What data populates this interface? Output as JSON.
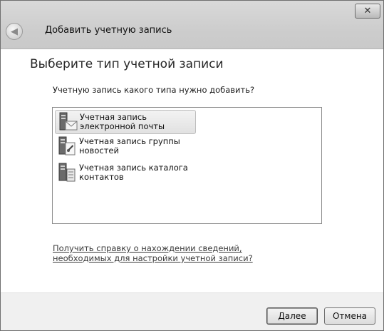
{
  "window": {
    "title": "Добавить учетную запись",
    "close_icon": "close-icon",
    "back_icon": "back-arrow-icon"
  },
  "main": {
    "heading": "Выберите тип учетной записи",
    "question": "Учетную запись какого типа нужно добавить?",
    "account_types": [
      {
        "label": "Учетная запись электронной почты",
        "icon": "email-account-icon",
        "selected": true
      },
      {
        "label": "Учетная запись группы новостей",
        "icon": "newsgroup-account-icon",
        "selected": false
      },
      {
        "label": "Учетная запись каталога контактов",
        "icon": "directory-service-icon",
        "selected": false
      }
    ],
    "help_link": "Получить справку о нахождении сведений, необходимых для настройки учетной записи?"
  },
  "footer": {
    "next_label": "Далее",
    "cancel_label": "Отмена"
  }
}
